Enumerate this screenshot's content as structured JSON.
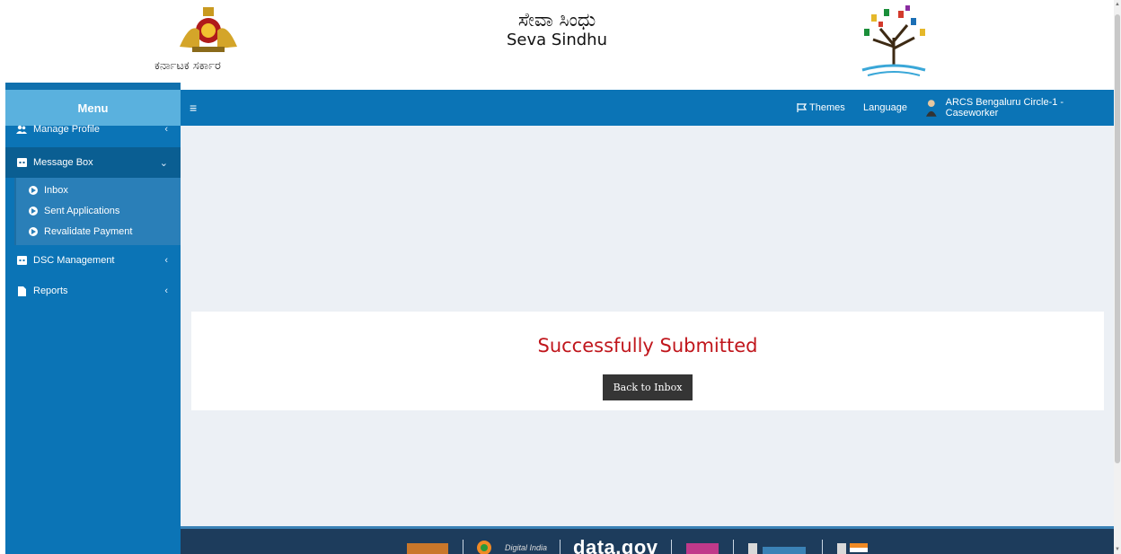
{
  "header": {
    "emblem_text": "ಕರ್ನಾಟಕ ಸರ್ಕಾರ",
    "title_kannada": "ಸೇವಾ ಸಿಂಧು",
    "title_english": "Seva Sindhu"
  },
  "sidebar": {
    "menu_title": "Menu",
    "items": [
      {
        "label": "Manage Profile",
        "icon": "users-icon"
      },
      {
        "label": "Message Box",
        "icon": "message-box-icon"
      },
      {
        "label": "DSC Management",
        "icon": "dsc-icon"
      },
      {
        "label": "Reports",
        "icon": "file-icon"
      }
    ],
    "submenu": [
      {
        "label": "Inbox"
      },
      {
        "label": "Sent Applications"
      },
      {
        "label": "Revalidate Payment"
      }
    ]
  },
  "topbar": {
    "themes_label": "Themes",
    "language_label": "Language",
    "user_label": "ARCS Bengaluru Circle-1 - Caseworker"
  },
  "main": {
    "status_message": "Successfully Submitted",
    "back_button_label": "Back to Inbox"
  },
  "footer": {
    "datagov_label": "data.gov",
    "digital_india_label": "Digital India"
  },
  "colors": {
    "primary": "#0b74b6",
    "menu_header": "#5ab1de",
    "success_text": "#c0161c",
    "button": "#353535"
  }
}
